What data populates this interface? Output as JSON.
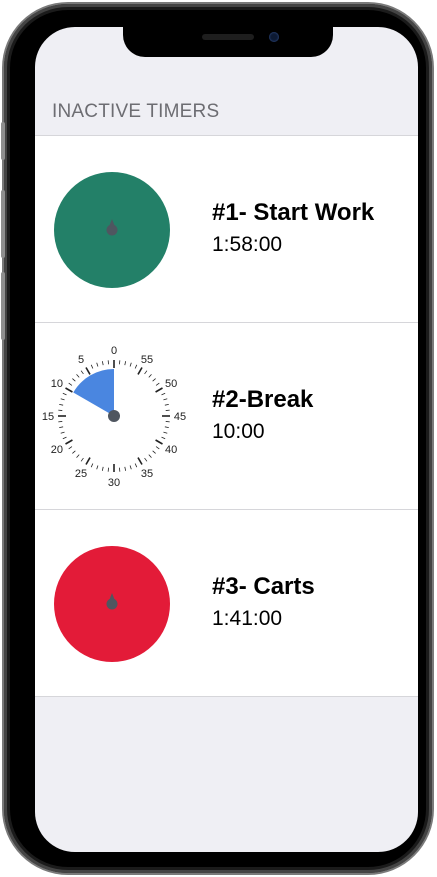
{
  "section_header": "INACTIVE TIMERS",
  "timers": [
    {
      "name": "#1- Start Work",
      "time": "1:58:00",
      "icon": "solid-disc",
      "color": "#238068"
    },
    {
      "name": "#2-Break",
      "time": "10:00",
      "icon": "clock-dial",
      "color": "#4a86e0",
      "remaining_minutes": 10
    },
    {
      "name": "#3- Carts",
      "time": "1:41:00",
      "icon": "solid-disc",
      "color": "#e31b38"
    }
  ],
  "dial_labels": [
    "0",
    "55",
    "50",
    "45",
    "40",
    "35",
    "30",
    "25",
    "20",
    "15",
    "10",
    "5"
  ],
  "colors": {
    "screen_bg": "#efeff4",
    "row_bg": "#ffffff",
    "header_text": "#6d6d72"
  }
}
